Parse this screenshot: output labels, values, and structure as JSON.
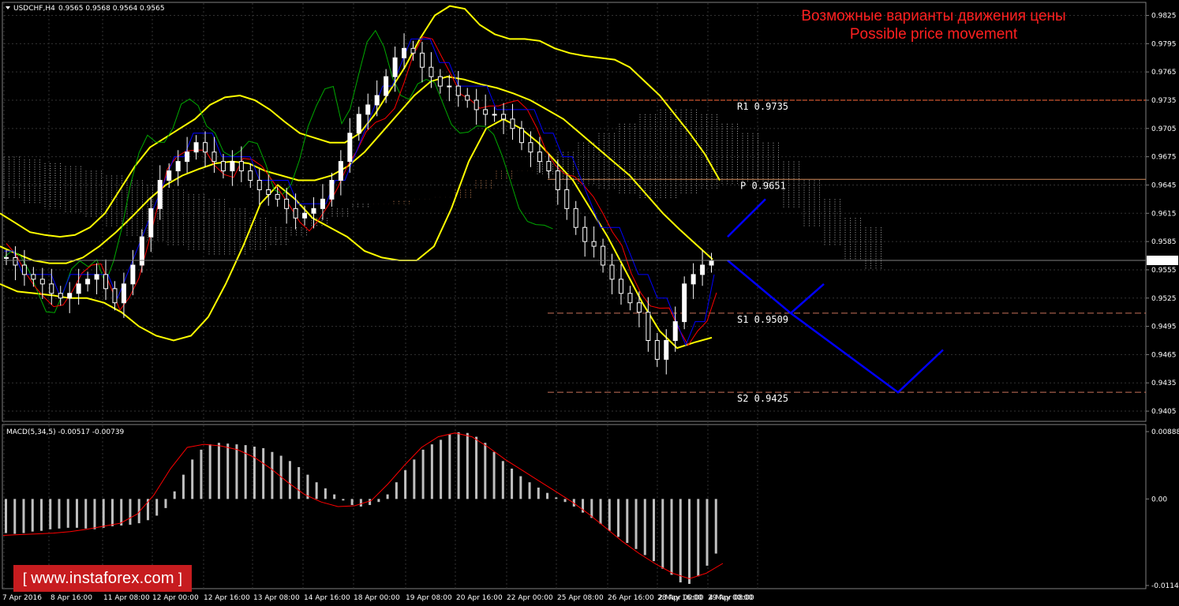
{
  "header": {
    "symbol": "USDCHF,H4",
    "ohlc": "0.9565 0.9568 0.9564 0.9565"
  },
  "annotation": {
    "line1": "Возможные варианты движения цены",
    "line2": "Possible price movement"
  },
  "macd": {
    "label": "MACD(5,34,5) -0.00517 -0.00739"
  },
  "brand": {
    "text": "www.instaforex.com"
  },
  "colors": {
    "background": "#000000",
    "bollinger": "#ffff00",
    "tenkan": "#ff0000",
    "kijun": "#0000ff",
    "chikou": "#00aa00",
    "candles": "#ffffff",
    "forecast": "#0000ff",
    "level_pivot": "#d08a5a",
    "level_dashed": "#c8725a",
    "annotation": "#ff2020",
    "macd_hist": "#c0c0c0",
    "macd_signal": "#ff0000"
  },
  "chart_data": {
    "type": "line",
    "symbol": "USDCHF",
    "timeframe": "H4",
    "y_range": [
      0.9395,
      0.9838
    ],
    "price_ticks": [
      "0.9825",
      "0.9795",
      "0.9765",
      "0.9735",
      "0.9705",
      "0.9675",
      "0.9645",
      "0.9615",
      "0.9585",
      "0.9555",
      "0.9525",
      "0.9495",
      "0.9465",
      "0.9435",
      "0.9405"
    ],
    "current_price": "0.9565",
    "time_labels": [
      "7 Apr 2016",
      "8 Apr 16:00",
      "11 Apr 08:00",
      "12 Apr 00:00",
      "12 Apr 16:00",
      "13 Apr 08:00",
      "14 Apr 16:00",
      "18 Apr 00:00",
      "19 Apr 08:00",
      "20 Apr 16:00",
      "22 Apr 00:00",
      "25 Apr 08:00",
      "26 Apr 16:00",
      "28 Apr 00:00",
      "29 Apr 08:00",
      "2 May 16:00",
      "4 May 00:00"
    ],
    "levels": [
      {
        "name": "R1",
        "value": "0.9735",
        "label": "R1  0.9735"
      },
      {
        "name": "P",
        "value": "0.9651",
        "label": "P  0.9651"
      },
      {
        "name": "S1",
        "value": "0.9509",
        "label": "S1  0.9509"
      },
      {
        "name": "S2",
        "value": "0.9425",
        "label": "S2  0.9425"
      }
    ],
    "close": [
      0.9568,
      0.956,
      0.955,
      0.9545,
      0.954,
      0.953,
      0.9525,
      0.953,
      0.954,
      0.9545,
      0.955,
      0.9535,
      0.952,
      0.954,
      0.956,
      0.959,
      0.962,
      0.965,
      0.966,
      0.967,
      0.968,
      0.969,
      0.968,
      0.967,
      0.966,
      0.967,
      0.966,
      0.965,
      0.964,
      0.9635,
      0.963,
      0.962,
      0.961,
      0.9615,
      0.962,
      0.963,
      0.965,
      0.967,
      0.97,
      0.972,
      0.973,
      0.974,
      0.976,
      0.978,
      0.979,
      0.9785,
      0.977,
      0.976,
      0.975,
      0.975,
      0.974,
      0.9735,
      0.9725,
      0.972,
      0.972,
      0.9715,
      0.9705,
      0.969,
      0.968,
      0.967,
      0.966,
      0.964,
      0.962,
      0.96,
      0.9585,
      0.958,
      0.956,
      0.9545,
      0.953,
      0.952,
      0.951,
      0.948,
      0.946,
      0.948,
      0.95,
      0.954,
      0.955,
      0.956,
      0.9565
    ],
    "bb_upper": [
      0.9615,
      0.9605,
      0.9595,
      0.9592,
      0.959,
      0.9592,
      0.96,
      0.9615,
      0.964,
      0.9665,
      0.9685,
      0.9695,
      0.9705,
      0.9715,
      0.973,
      0.9738,
      0.974,
      0.9735,
      0.9725,
      0.9712,
      0.97,
      0.9695,
      0.969,
      0.969,
      0.97,
      0.972,
      0.9745,
      0.977,
      0.98,
      0.9825,
      0.9835,
      0.9832,
      0.9815,
      0.9805,
      0.98,
      0.98,
      0.9798,
      0.979,
      0.9785,
      0.9782,
      0.978,
      0.9778,
      0.977,
      0.9755,
      0.974,
      0.972,
      0.97,
      0.9678,
      0.965
    ],
    "bb_mid": [
      0.958,
      0.9572,
      0.9565,
      0.9562,
      0.9562,
      0.9568,
      0.958,
      0.9595,
      0.9612,
      0.963,
      0.9645,
      0.9655,
      0.9662,
      0.9668,
      0.967,
      0.9668,
      0.966,
      0.9655,
      0.965,
      0.965,
      0.9655,
      0.9665,
      0.968,
      0.97,
      0.972,
      0.974,
      0.9755,
      0.976,
      0.9757,
      0.9752,
      0.9748,
      0.9742,
      0.9735,
      0.9725,
      0.9715,
      0.97,
      0.9685,
      0.967,
      0.9655,
      0.9635,
      0.9615,
      0.9598,
      0.9582,
      0.9566
    ],
    "bb_lower": [
      0.954,
      0.9532,
      0.953,
      0.9528,
      0.9525,
      0.9525,
      0.952,
      0.951,
      0.9495,
      0.9485,
      0.948,
      0.9485,
      0.9505,
      0.954,
      0.958,
      0.9625,
      0.9645,
      0.963,
      0.961,
      0.96,
      0.959,
      0.9575,
      0.9568,
      0.9565,
      0.9565,
      0.958,
      0.962,
      0.967,
      0.9705,
      0.9715,
      0.9705,
      0.969,
      0.967,
      0.965,
      0.962,
      0.959,
      0.9555,
      0.952,
      0.949,
      0.9472,
      0.9478,
      0.9483
    ],
    "forecast_paths": [
      {
        "name": "up",
        "points": [
          [
            "4 May 00:00",
            0.959
          ],
          [
            "next",
            0.963
          ]
        ]
      },
      {
        "name": "down",
        "points": [
          [
            "4 May 00:00",
            0.9565
          ],
          [
            "next",
            0.9509
          ],
          [
            "next",
            0.954
          ],
          [
            "next",
            0.9425
          ],
          [
            "next",
            0.947
          ]
        ]
      }
    ],
    "macd": {
      "params": "5,34,5",
      "main": "-0.00517",
      "signal": "-0.00739",
      "y_ticks": [
        "0.00888",
        "0.00",
        "-0.01141"
      ],
      "hist": [
        -0.0045,
        -0.0046,
        -0.0045,
        -0.0043,
        -0.0042,
        -0.004,
        -0.0039,
        -0.0038,
        -0.0038,
        -0.0039,
        -0.004,
        -0.0038,
        -0.0036,
        -0.0035,
        -0.0034,
        -0.0032,
        -0.0028,
        -0.0022,
        -0.0012,
        0.001,
        0.0032,
        0.0052,
        0.0065,
        0.0072,
        0.0074,
        0.0073,
        0.0072,
        0.0071,
        0.0069,
        0.0067,
        0.0062,
        0.0057,
        0.005,
        0.0042,
        0.0032,
        0.0022,
        0.0014,
        0.0006,
        -0.0002,
        -0.0008,
        -0.001,
        -0.0008,
        -0.0004,
        0.0006,
        0.0022,
        0.0038,
        0.0052,
        0.0065,
        0.0072,
        0.0078,
        0.0085,
        0.0088,
        0.0087,
        0.0082,
        0.0074,
        0.0062,
        0.005,
        0.004,
        0.003,
        0.0022,
        0.0015,
        0.0008,
        0.0002,
        -0.0004,
        -0.001,
        -0.0018,
        -0.0025,
        -0.0033,
        -0.0042,
        -0.005,
        -0.0058,
        -0.0066,
        -0.0074,
        -0.0082,
        -0.0092,
        -0.01,
        -0.011,
        -0.0112,
        -0.0102,
        -0.0088,
        -0.0072
      ],
      "signal_line": [
        -0.0048,
        -0.0047,
        -0.0046,
        -0.0045,
        -0.0043,
        -0.004,
        -0.0036,
        -0.0032,
        -0.002,
        0.0005,
        0.004,
        0.0068,
        0.0072,
        0.007,
        0.0065,
        0.0055,
        0.004,
        0.0022,
        0.0006,
        -0.0004,
        -0.001,
        -0.0009,
        -0.0002,
        0.002,
        0.0045,
        0.0068,
        0.0082,
        0.0087,
        0.0082,
        0.0068,
        0.0052,
        0.0038,
        0.0024,
        0.001,
        -0.0004,
        -0.002,
        -0.0038,
        -0.0056,
        -0.0072,
        -0.0086,
        -0.0098,
        -0.0105,
        -0.0098,
        -0.0085
      ]
    }
  }
}
